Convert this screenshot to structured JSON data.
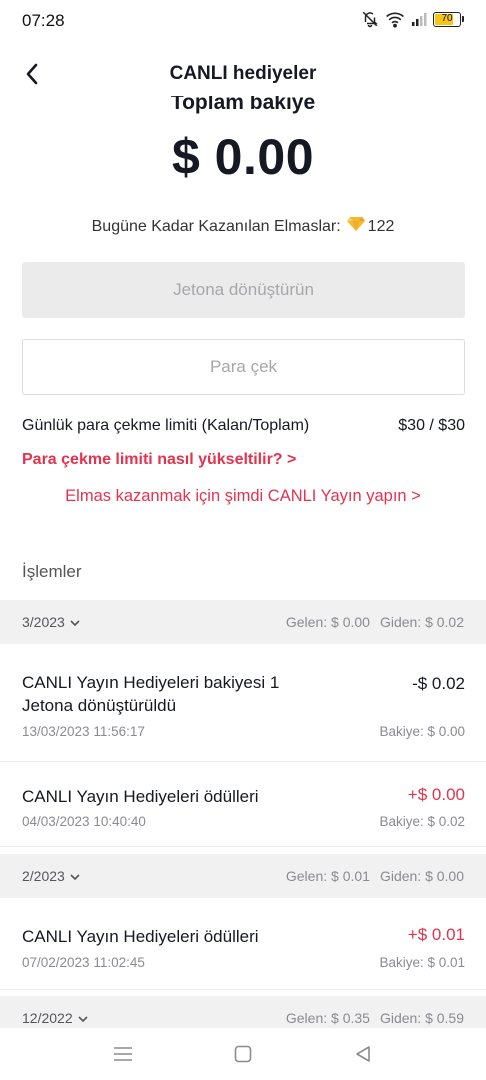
{
  "status_bar": {
    "time": "07:28",
    "battery": "70",
    "icons": [
      "mute-icon",
      "wifi-icon",
      "signal-icon",
      "battery-icon"
    ]
  },
  "nav": {
    "title": "CANLI hediyeler",
    "back_icon": "chevron-left-icon"
  },
  "balance": {
    "label": "Toplam bakiye",
    "amount": "$ 0.00",
    "diamonds_label": "Bugüne Kadar Kazanılan Elmaslar:",
    "diamonds_count": "122",
    "diamond_color": "#f5b82e"
  },
  "actions": {
    "convert_label": "Jetona dönüştürün",
    "withdraw_label": "Para çek"
  },
  "limit": {
    "label": "Günlük para çekme limiti (Kalan/Toplam)",
    "value": "$30 / $30",
    "increase_link": "Para çekme limiti nasıl yükseltilir? >",
    "live_link": "Elmas kazanmak için şimdi CANLI Yayın yapın >"
  },
  "transactions": {
    "title": "İşlemler",
    "months": [
      {
        "label": "3/2023",
        "incoming": "Gelen: $ 0.00",
        "outgoing": "Giden: $ 0.02",
        "items": [
          {
            "title_line1": "CANLI Yayın Hediyeleri bakiyesi 1",
            "title_line2": "Jetona dönüştürüldü",
            "amount": "-$ 0.02",
            "date": "13/03/2023 11:56:17",
            "balance": "Bakiye: $ 0.00"
          },
          {
            "title_line1": "CANLI Yayın Hediyeleri ödülleri",
            "amount": "+$ 0.00",
            "date": "04/03/2023 10:40:40",
            "balance": "Bakiye: $ 0.02"
          }
        ]
      },
      {
        "label": "2/2023",
        "incoming": "Gelen: $ 0.01",
        "outgoing": "Giden: $ 0.00",
        "items": [
          {
            "title_line1": "CANLI Yayın Hediyeleri ödülleri",
            "amount": "+$ 0.01",
            "date": "07/02/2023 11:02:45",
            "balance": "Bakiye: $ 0.01"
          }
        ]
      },
      {
        "label": "12/2022",
        "incoming": "Gelen: $ 0.35",
        "outgoing": "Giden: $ 0.59",
        "items": []
      }
    ]
  },
  "colors": {
    "accent": "#e4334f",
    "text": "#161823",
    "muted": "#8a8b91",
    "header_bg": "#f1f1f2",
    "button_disabled_bg": "#ebebeb"
  }
}
